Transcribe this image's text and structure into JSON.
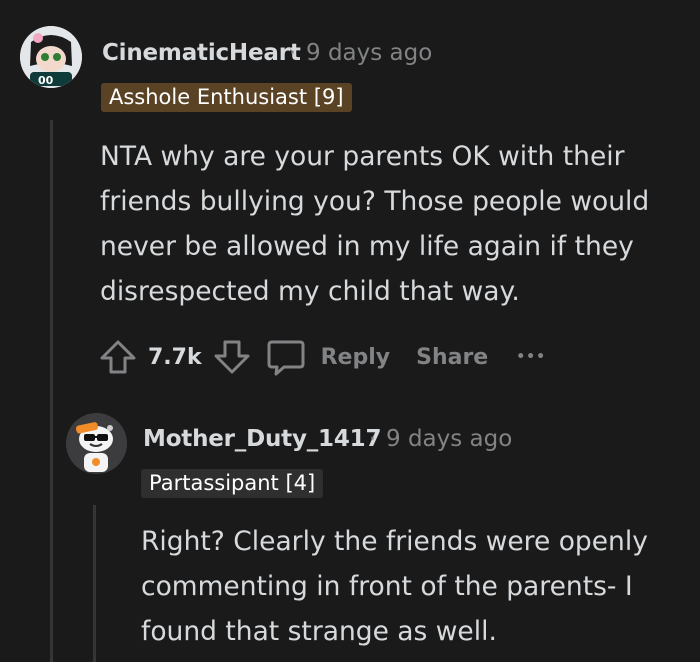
{
  "comments": [
    {
      "username": "CinematicHeart",
      "timestamp": "9 days ago",
      "flair": "Asshole Enthusiast [9]",
      "body": "NTA why are your parents OK with their friends bullying you? Those people would never be allowed in my life again if they disrespected my child that way.",
      "votes": "7.7k",
      "reply_label": "Reply",
      "share_label": "Share",
      "more_label": "•••"
    },
    {
      "username": "Mother_Duty_1417",
      "timestamp": "9 days ago",
      "flair": "Partassipant [4]",
      "body": "Right? Clearly the friends were openly commenting in front of the parents- I found that strange as well."
    }
  ],
  "separator": "·",
  "colors": {
    "background": "#1a1a1b",
    "text": "#d7dadc",
    "meta": "#818384",
    "flair_brown": "#5a4225",
    "flair_dark": "#2f2f30",
    "thread_line": "#343536"
  }
}
